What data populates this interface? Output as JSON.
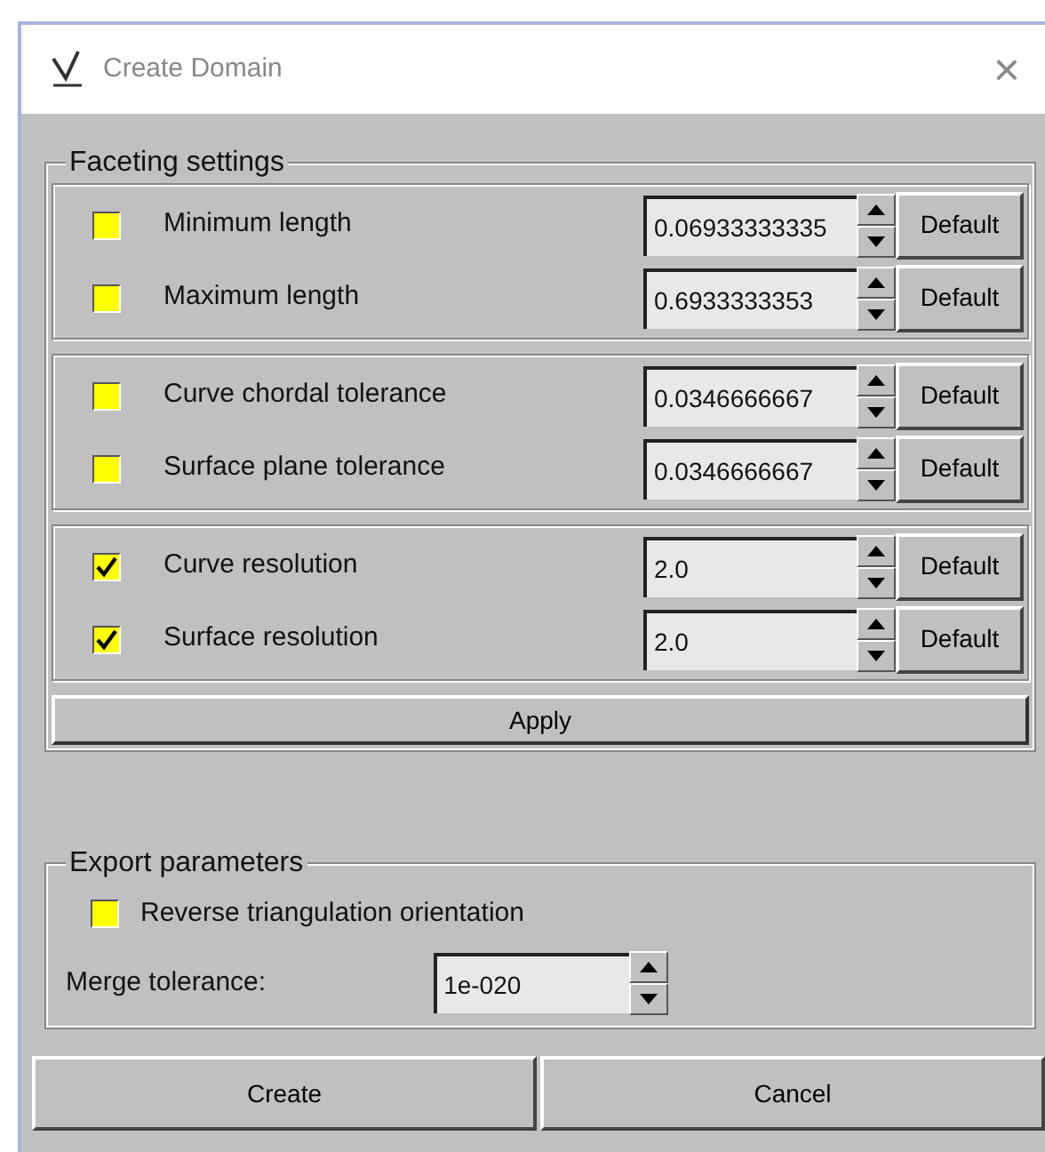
{
  "window": {
    "title": "Create Domain",
    "close": "×"
  },
  "faceting_settings": {
    "title": "Faceting settings",
    "groups": [
      {
        "rows": [
          {
            "label": "Minimum length",
            "checked": false,
            "value": "0.06933333335",
            "button": "Default"
          },
          {
            "label": "Maximum length",
            "checked": false,
            "value": "0.6933333353",
            "button": "Default"
          }
        ]
      },
      {
        "rows": [
          {
            "label": "Curve chordal tolerance",
            "checked": false,
            "value": "0.0346666667",
            "button": "Default"
          },
          {
            "label": "Surface plane tolerance",
            "checked": false,
            "value": "0.0346666667",
            "button": "Default"
          }
        ]
      },
      {
        "rows": [
          {
            "label": "Curve resolution",
            "checked": true,
            "value": "2.0",
            "button": "Default"
          },
          {
            "label": "Surface resolution",
            "checked": true,
            "value": "2.0",
            "button": "Default"
          }
        ]
      }
    ],
    "apply": "Apply"
  },
  "export_parameters": {
    "title": "Export parameters",
    "reverse": {
      "label": "Reverse triangulation orientation",
      "checked": false
    },
    "merge_tolerance": {
      "label": "Merge tolerance:",
      "value": "1e-020"
    }
  },
  "buttons": [
    "Create",
    "Cancel"
  ]
}
